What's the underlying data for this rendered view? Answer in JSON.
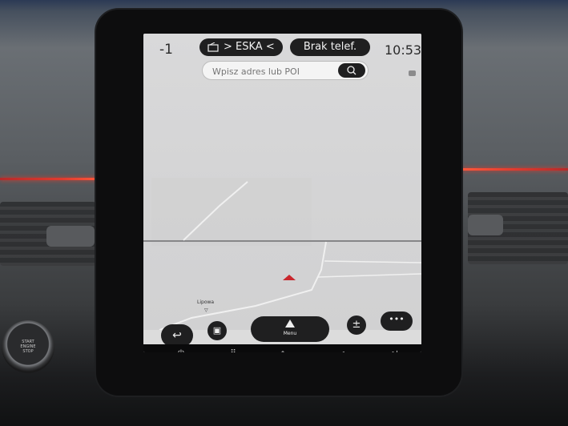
{
  "status": {
    "floor_level": "-1",
    "radio_label": "> ESKA <",
    "radio_icon": "radio-icon",
    "phone_label": "Brak telef.",
    "time": "10:53"
  },
  "search": {
    "placeholder": "Wpisz adres lub POI",
    "icon": "search-icon"
  },
  "map": {
    "poi_label": "Lipowa",
    "cursor_color": "#c9272d"
  },
  "controls": {
    "menu_label": "Menu",
    "back_icon": "back-arrow-icon",
    "view_icon": "map-view-icon",
    "zoom_icon": "zoom-icon",
    "more_icon": "more-icon"
  },
  "system_bar": {
    "items": [
      "power-icon",
      "apps-grid-icon",
      "home-icon",
      "volume-down-icon",
      "volume-up-icon"
    ]
  },
  "hardware": {
    "start_lines": [
      "START",
      "ENGINE",
      "STOP"
    ]
  },
  "colors": {
    "accent_red": "#e03b2e",
    "pill_dark": "#1f1f20"
  }
}
